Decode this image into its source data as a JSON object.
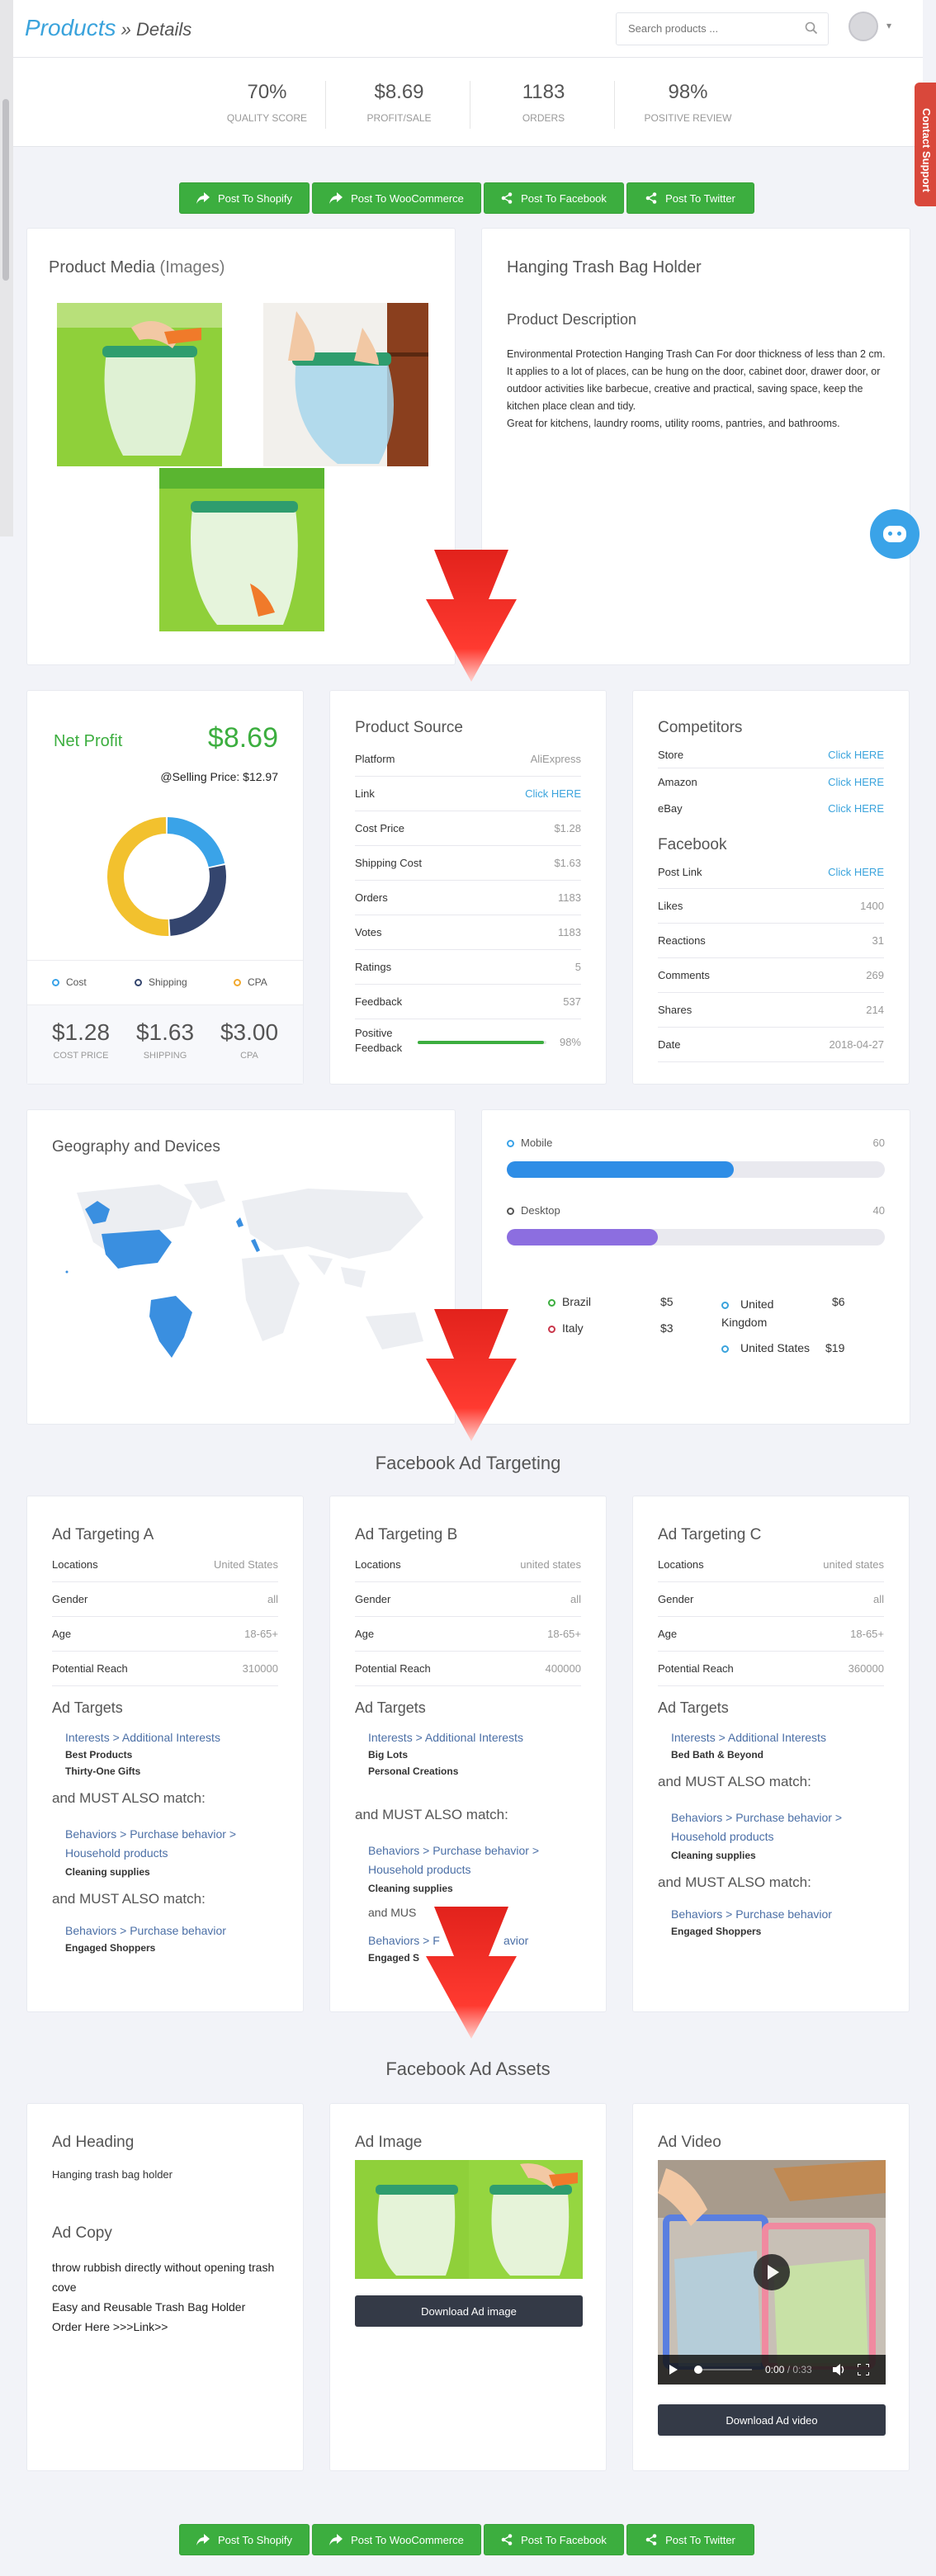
{
  "header": {
    "brand": "Products",
    "separator": " » ",
    "page": "Details",
    "search_placeholder": "Search products ...",
    "contact": "Contact Support"
  },
  "stats": [
    {
      "value": "70%",
      "label": "QUALITY SCORE"
    },
    {
      "value": "$8.69",
      "label": "PROFIT/SALE"
    },
    {
      "value": "1183",
      "label": "ORDERS"
    },
    {
      "value": "98%",
      "label": "POSITIVE REVIEW"
    }
  ],
  "actions": {
    "shopify": "Post To Shopify",
    "woocommerce": "Post To WooCommerce",
    "facebook": "Post To Facebook",
    "twitter": "Post To Twitter"
  },
  "media": {
    "title": "Product Media",
    "title_suffix": "(Images)"
  },
  "product": {
    "name": "Hanging Trash Bag Holder",
    "desc_title": "Product Description",
    "desc_lines": [
      "Environmental Protection Hanging Trash Can For door thickness of less than 2 cm.",
      "It applies to a lot of places, can be hung on the door, cabinet door, drawer door, or outdoor activities like barbecue, creative and practical, saving space, keep the kitchen place clean and tidy.",
      "Great for kitchens, laundry rooms, utility rooms, pantries, and bathrooms."
    ]
  },
  "profit": {
    "label": "Net Profit",
    "value": "$8.69",
    "selling": "@Selling Price: $12.97",
    "donut": [
      {
        "name": "Cost",
        "value": 1.28,
        "color": "#3aa3e8"
      },
      {
        "name": "Shipping",
        "value": 1.63,
        "color": "#34456e"
      },
      {
        "name": "CPA",
        "value": 3.0,
        "color": "#f2c12e"
      }
    ],
    "legend": [
      "Cost",
      "Shipping",
      "CPA"
    ],
    "figures": [
      {
        "value": "$1.28",
        "label": "COST PRICE"
      },
      {
        "value": "$1.63",
        "label": "SHIPPING"
      },
      {
        "value": "$3.00",
        "label": "CPA"
      }
    ]
  },
  "source": {
    "title": "Product Source",
    "rows": [
      {
        "k": "Platform",
        "v": "AliExpress"
      },
      {
        "k": "Link",
        "v": "Click HERE"
      },
      {
        "k": "Cost Price",
        "v": "$1.28"
      },
      {
        "k": "Shipping Cost",
        "v": "$1.63"
      },
      {
        "k": "Orders",
        "v": "1183"
      },
      {
        "k": "Votes",
        "v": "1183"
      },
      {
        "k": "Ratings",
        "v": "5"
      },
      {
        "k": "Feedback",
        "v": "537"
      }
    ],
    "positive_label_1": "Positive",
    "positive_label_2": "Feedback",
    "positive_value": "98%",
    "positive_fraction": 0.98
  },
  "competitors": {
    "title": "Competitors",
    "rows": [
      {
        "k": "Store",
        "v": "Click HERE"
      },
      {
        "k": "Amazon",
        "v": "Click HERE"
      },
      {
        "k": "eBay",
        "v": "Click HERE"
      }
    ],
    "fb_title": "Facebook",
    "fb_rows": [
      {
        "k": "Post Link",
        "v": "Click HERE"
      },
      {
        "k": "Likes",
        "v": "1400"
      },
      {
        "k": "Reactions",
        "v": "31"
      },
      {
        "k": "Comments",
        "v": "269"
      },
      {
        "k": "Shares",
        "v": "214"
      },
      {
        "k": "Date",
        "v": "2018-04-27"
      }
    ]
  },
  "geo": {
    "title": "Geography and Devices",
    "devices": [
      {
        "name": "Mobile",
        "value": "60",
        "fraction": 0.6,
        "color": "#2e8de6"
      },
      {
        "name": "Desktop",
        "value": "40",
        "fraction": 0.4,
        "color": "#8c6ee0"
      }
    ],
    "countries": [
      {
        "name": "Brazil",
        "value": "$5",
        "color": "#3cae3f"
      },
      {
        "name": "Italy",
        "value": "$3",
        "color": "#c9364a"
      },
      {
        "name": "United Kingdom",
        "value": "$6",
        "color": "#3aa3dc"
      },
      {
        "name": "United States",
        "value": "$19",
        "color": "#3aa3dc"
      }
    ]
  },
  "targeting": {
    "title": "Facebook Ad Targeting",
    "cols": [
      {
        "title": "Ad Targeting A",
        "rows": [
          {
            "k": "Locations",
            "v": "United States"
          },
          {
            "k": "Gender",
            "v": "all"
          },
          {
            "k": "Age",
            "v": "18-65+"
          },
          {
            "k": "Potential Reach",
            "v": "310000"
          }
        ],
        "targets_title": "Ad Targets",
        "interest": "Interests > Additional Interests",
        "interest_items": [
          "Best Products",
          "Thirty-One Gifts"
        ],
        "match1": "and MUST ALSO match:",
        "b1": "Behaviors > Purchase behavior > Household products",
        "b1_item": "Cleaning supplies",
        "match2": "and MUST ALSO match:",
        "b2": "Behaviors > Purchase behavior",
        "b2_item": "Engaged Shoppers"
      },
      {
        "title": "Ad Targeting B",
        "rows": [
          {
            "k": "Locations",
            "v": "united states"
          },
          {
            "k": "Gender",
            "v": "all"
          },
          {
            "k": "Age",
            "v": "18-65+"
          },
          {
            "k": "Potential Reach",
            "v": "400000"
          }
        ],
        "targets_title": "Ad Targets",
        "interest": "Interests > Additional Interests",
        "interest_items": [
          "Big Lots",
          "Personal Creations"
        ],
        "match1": "and MUST ALSO match:",
        "b1": "Behaviors > Purchase behavior > Household products",
        "b1_item": "Cleaning supplies",
        "match2": "and MUST ALSO match:",
        "b2": "Behaviors > Purchase behavior",
        "b2_item": "Engaged Shoppers"
      },
      {
        "title": "Ad Targeting C",
        "rows": [
          {
            "k": "Locations",
            "v": "united states"
          },
          {
            "k": "Gender",
            "v": "all"
          },
          {
            "k": "Age",
            "v": "18-65+"
          },
          {
            "k": "Potential Reach",
            "v": "360000"
          }
        ],
        "targets_title": "Ad Targets",
        "interest": "Interests > Additional Interests",
        "interest_items": [
          "Bed Bath & Beyond"
        ],
        "match1": "and MUST ALSO match:",
        "b1": "Behaviors > Purchase behavior > Household products",
        "b1_item": "Cleaning supplies",
        "match2": "and MUST ALSO match:",
        "b2": "Behaviors > Purchase behavior",
        "b2_item": "Engaged Shoppers"
      }
    ],
    "b_partial_match": "and MUS",
    "b_partial_beh": "Behaviors > F",
    "b_partial_beh_end": "avior",
    "b_partial_item": "Engaged S"
  },
  "assets": {
    "title": "Facebook Ad Assets",
    "heading_title": "Ad Heading",
    "heading": "Hanging trash bag holder",
    "copy_title": "Ad Copy",
    "copy_lines": [
      "throw rubbish directly without opening trash cove",
      "Easy and Reusable Trash Bag Holder",
      "Order Here >>>Link>>"
    ],
    "image_title": "Ad Image",
    "image_btn": "Download Ad image",
    "video_title": "Ad Video",
    "video_time": "0:00",
    "video_sep": " / ",
    "video_total": "0:33",
    "video_btn": "Download Ad video"
  }
}
